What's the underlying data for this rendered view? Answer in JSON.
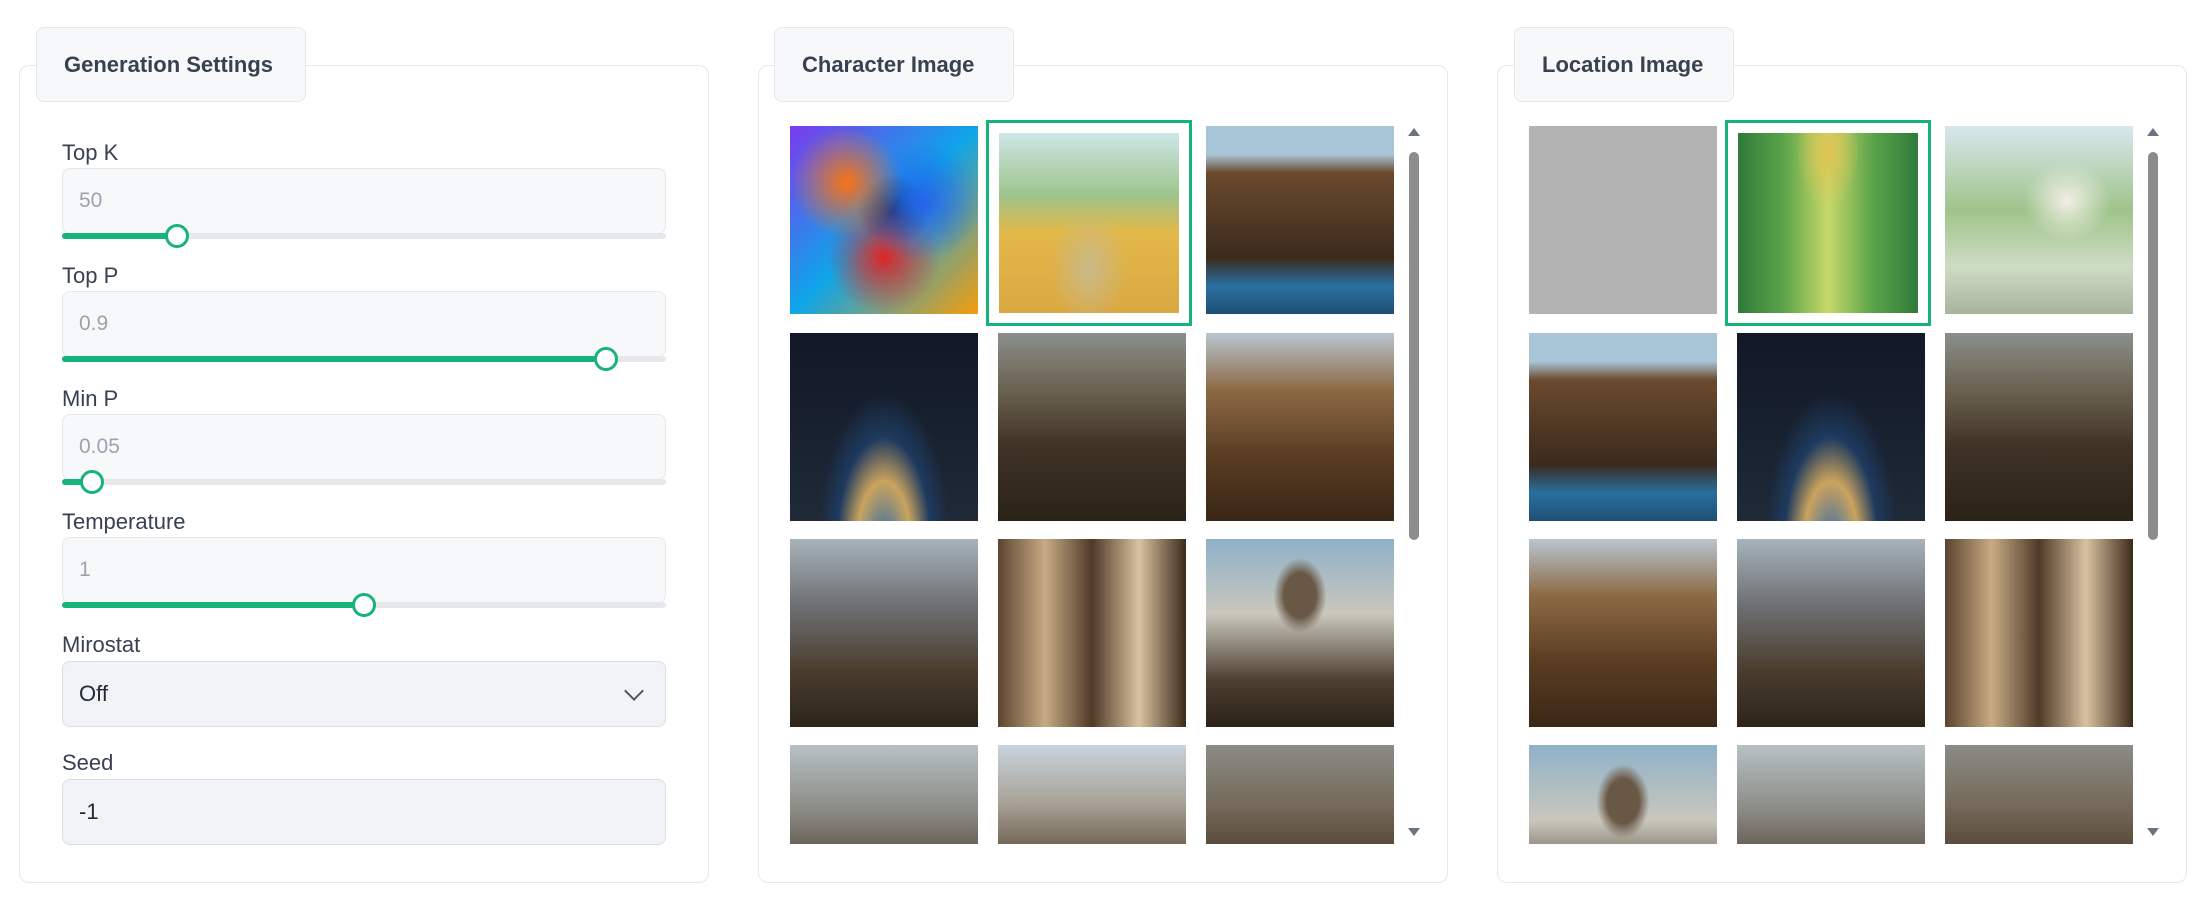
{
  "settings": {
    "tab_label": "Generation Settings",
    "top_k": {
      "label": "Top K",
      "value": "50",
      "fraction": 0.19
    },
    "top_p": {
      "label": "Top P",
      "value": "0.9",
      "fraction": 0.9
    },
    "min_p": {
      "label": "Min P",
      "value": "0.05",
      "fraction": 0.05
    },
    "temperature": {
      "label": "Temperature",
      "value": "1",
      "fraction": 0.5
    },
    "mirostat": {
      "label": "Mirostat",
      "value": "Off"
    },
    "seed": {
      "label": "Seed",
      "value": "-1"
    }
  },
  "character_gallery": {
    "tab_label": "Character Image",
    "selected_index": 1,
    "images": [
      "abstract-colorful-smoke-figure",
      "girl-with-dog-on-country-road",
      "steampunk-harbor-town",
      "space-station-over-earth",
      "steampunk-towers-with-bridge",
      "steampunk-mansion",
      "steampunk-city-skyline",
      "steampunk-machines-collage",
      "steampunk-dome-tower",
      "steampunk-city-towers",
      "steampunk-domes-city",
      "steampunk-factory-domes"
    ]
  },
  "location_gallery": {
    "tab_label": "Location Image",
    "selected_index": 1,
    "images": [
      "blank-gray-placeholder",
      "stained-glass-cathedral-interior",
      "watercolor-cottage-by-stream",
      "steampunk-harbor-town",
      "space-station-over-earth",
      "steampunk-towers-with-bridge",
      "steampunk-mansion",
      "steampunk-city-skyline",
      "steampunk-machines-collage",
      "steampunk-dome-tower",
      "steampunk-city-towers",
      "steampunk-factory-domes"
    ]
  },
  "colors": {
    "accent": "#16b37b",
    "track": "#e5e7eb"
  }
}
